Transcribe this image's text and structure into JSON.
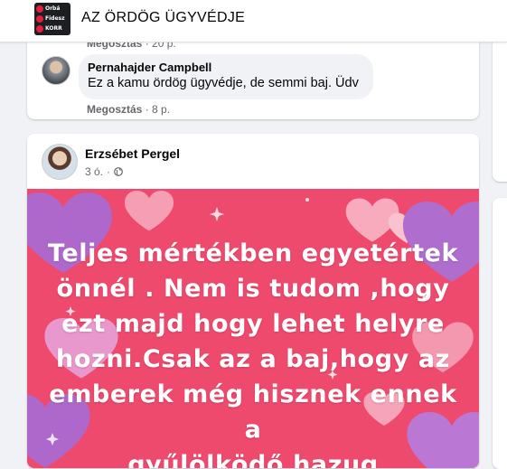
{
  "header": {
    "group_title": "AZ ÖRDÖG ÜGYVÉDJE",
    "thumb_labels": [
      "Orbá",
      "Fidesz",
      "KORR"
    ]
  },
  "comment_card": {
    "top_meta": {
      "action": "Megosztás",
      "time": "20 p."
    },
    "comment": {
      "author": "Pernahajder Campbell",
      "text": "Ez a kamu ördög ügyvédje, de semmi baj. Üdv"
    },
    "bottom_meta": {
      "action": "Megosztás",
      "time": "8 p."
    }
  },
  "post": {
    "author": "Erzsébet Pergel",
    "time": "3 ó.",
    "privacy_icon": "globe-icon",
    "background_color": "#ee4a6d",
    "text": "Teljes mértékben egyetértek\nönnél . Nem is tudom ,hogy\nezt majd hogy lehet helyre\nhozni.Csak az a baj,hogy az\nemberek még hisznek ennek a\ngyűlölködő hazug"
  }
}
